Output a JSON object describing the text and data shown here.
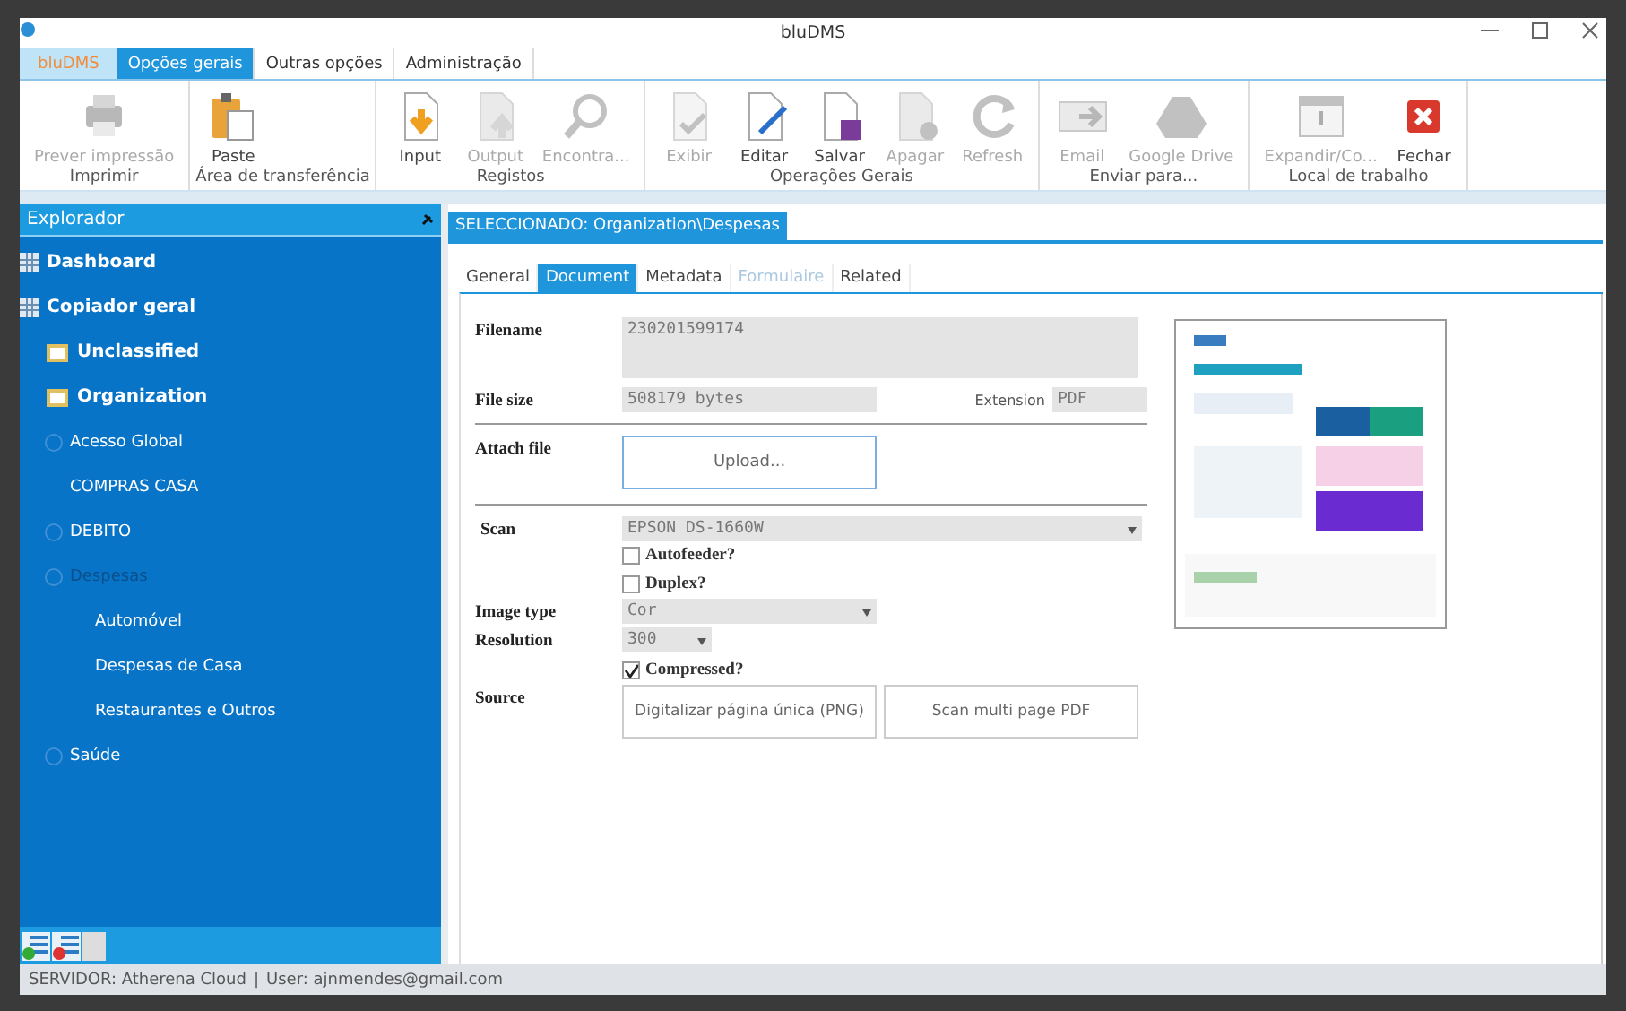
{
  "window": {
    "title": "bluDMS"
  },
  "ribbon_tabs": [
    {
      "label": "bluDMS",
      "selected": false,
      "kind": "app"
    },
    {
      "label": "Opções gerais",
      "selected": true,
      "kind": "tab"
    },
    {
      "label": "Outras opções",
      "selected": false,
      "kind": "tab"
    },
    {
      "label": "Administração",
      "selected": false,
      "kind": "tab"
    }
  ],
  "ribbon_groups": [
    {
      "title": "Imprimir",
      "buttons": [
        {
          "label": "Prever impressão",
          "disabled": true
        }
      ]
    },
    {
      "title": "Área de transferência",
      "buttons": [
        {
          "label": "Paste",
          "disabled": false
        }
      ]
    },
    {
      "title": "Registos",
      "buttons": [
        {
          "label": "Input",
          "disabled": false
        },
        {
          "label": "Output",
          "disabled": true
        },
        {
          "label": "Encontra...",
          "disabled": true
        }
      ]
    },
    {
      "title": "Operações Gerais",
      "buttons": [
        {
          "label": "Exibir",
          "disabled": true
        },
        {
          "label": "Editar",
          "disabled": false
        },
        {
          "label": "Salvar",
          "disabled": false
        },
        {
          "label": "Apagar",
          "disabled": true
        },
        {
          "label": "Refresh",
          "disabled": true
        }
      ]
    },
    {
      "title": "Enviar para...",
      "buttons": [
        {
          "label": "Email",
          "disabled": true
        },
        {
          "label": "Google Drive",
          "disabled": true
        }
      ]
    },
    {
      "title": "Local de trabalho",
      "buttons": [
        {
          "label": "Expandir/Co...",
          "disabled": true
        },
        {
          "label": "Fechar",
          "disabled": false
        }
      ]
    }
  ],
  "explorer": {
    "title": "Explorador",
    "items": [
      {
        "label": "Dashboard",
        "selected": false,
        "kind": "top"
      },
      {
        "label": "Copiador geral",
        "selected": false,
        "kind": "top",
        "children": [
          {
            "label": "Unclassified",
            "selected": false,
            "kind": "folder"
          },
          {
            "label": "Organization",
            "selected": false,
            "kind": "folder",
            "children": [
              {
                "label": "Acesso Global",
                "selected": false,
                "kind": "node"
              },
              {
                "label": "COMPRAS CASA",
                "selected": false,
                "kind": "leaf"
              },
              {
                "label": "DEBITO",
                "selected": false,
                "kind": "node"
              },
              {
                "label": "Despesas",
                "selected": true,
                "kind": "node",
                "children": [
                  {
                    "label": "Automóvel",
                    "selected": false,
                    "kind": "leaf"
                  },
                  {
                    "label": "Despesas de Casa",
                    "selected": false,
                    "kind": "leaf"
                  },
                  {
                    "label": "Restaurantes e Outros",
                    "selected": false,
                    "kind": "leaf"
                  }
                ]
              },
              {
                "label": "Saúde",
                "selected": false,
                "kind": "node"
              }
            ]
          }
        ]
      }
    ]
  },
  "document_tab": {
    "label": "SELECCIONADO: Organization\\Despesas"
  },
  "detail_tabs": [
    {
      "label": "General",
      "selected": false,
      "disabled": false
    },
    {
      "label": "Document",
      "selected": true,
      "disabled": false
    },
    {
      "label": "Metadata",
      "selected": false,
      "disabled": false
    },
    {
      "label": "Formulaire",
      "selected": false,
      "disabled": true
    },
    {
      "label": "Related",
      "selected": false,
      "disabled": false
    }
  ],
  "form": {
    "filename_label": "Filename",
    "filename": "230201599174",
    "file_size_label": "File size",
    "file_size": "508179 bytes",
    "extension_label": "Extension",
    "extension": "PDF",
    "attach_label": "Attach file",
    "upload_button": "Upload...",
    "scan_label": "Scan",
    "scanner": "EPSON DS-1660W",
    "options": [
      {
        "label": "Autofeeder?",
        "checked": false
      },
      {
        "label": "Duplex?",
        "checked": false
      }
    ],
    "image_type_label": "Image type",
    "image_type": "Cor",
    "resolution_label": "Resolution",
    "resolution": "300",
    "compressed": {
      "label": "Compressed?",
      "checked": true
    },
    "source_label": "Source",
    "source_buttons": [
      "Digitalizar página única (PNG)",
      "Scan multi page PDF"
    ]
  },
  "status_bar": {
    "server": "SERVIDOR: Atherena Cloud",
    "separator": "|",
    "user": "User: ajnmendes@gmail.com"
  }
}
